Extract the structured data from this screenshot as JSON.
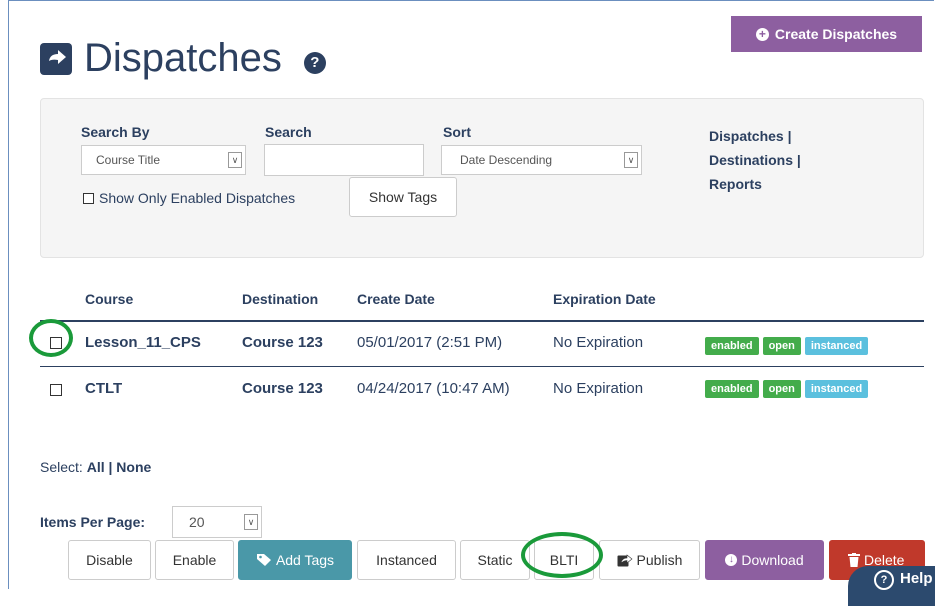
{
  "header": {
    "title": "Dispatches",
    "help_glyph": "?",
    "create_button": "Create Dispatches"
  },
  "filters": {
    "search_by_label": "Search By",
    "search_by_value": "Course Title",
    "search_label": "Search",
    "search_value": "",
    "sort_label": "Sort",
    "sort_value": "Date Descending",
    "show_only_enabled": "Show Only Enabled Dispatches",
    "show_tags": "Show Tags",
    "nav": [
      "Dispatches |",
      "Destinations |",
      "Reports"
    ]
  },
  "table": {
    "headers": {
      "course": "Course",
      "destination": "Destination",
      "create_date": "Create Date",
      "expiration_date": "Expiration Date"
    },
    "rows": [
      {
        "course": "Lesson_11_CPS",
        "destination": "Course 123",
        "create_date": "05/01/2017 (2:51 PM)",
        "expiration": "No Expiration",
        "badges": [
          "enabled",
          "open",
          "instanced"
        ]
      },
      {
        "course": "CTLT",
        "destination": "Course 123",
        "create_date": "04/24/2017 (10:47 AM)",
        "expiration": "No Expiration",
        "badges": [
          "enabled",
          "open",
          "instanced"
        ]
      }
    ]
  },
  "selection": {
    "prefix": "Select:",
    "all": "All",
    "separator": "|",
    "none": "None"
  },
  "paging": {
    "label": "Items Per Page:",
    "value": "20"
  },
  "toolbar": {
    "disable": "Disable",
    "enable": "Enable",
    "add_tags": "Add Tags",
    "instanced": "Instanced",
    "static": "Static",
    "blti": "BLTI",
    "publish": "Publish",
    "download": "Download",
    "delete": "Delete"
  },
  "help_tab": "Help",
  "colors": {
    "navy": "#2c4060",
    "purple": "#8d5fa0",
    "teal": "#4a98a8",
    "red": "#c0392b",
    "badge_green": "#43ac4b",
    "badge_blue": "#5bc0de",
    "annotation_ring": "#1a9a3a"
  },
  "icons": [
    "share-icon",
    "help-circle-icon",
    "plus-circle-icon",
    "tag-icon",
    "publish-icon",
    "download-icon",
    "trash-icon",
    "chevron-down-icon"
  ]
}
